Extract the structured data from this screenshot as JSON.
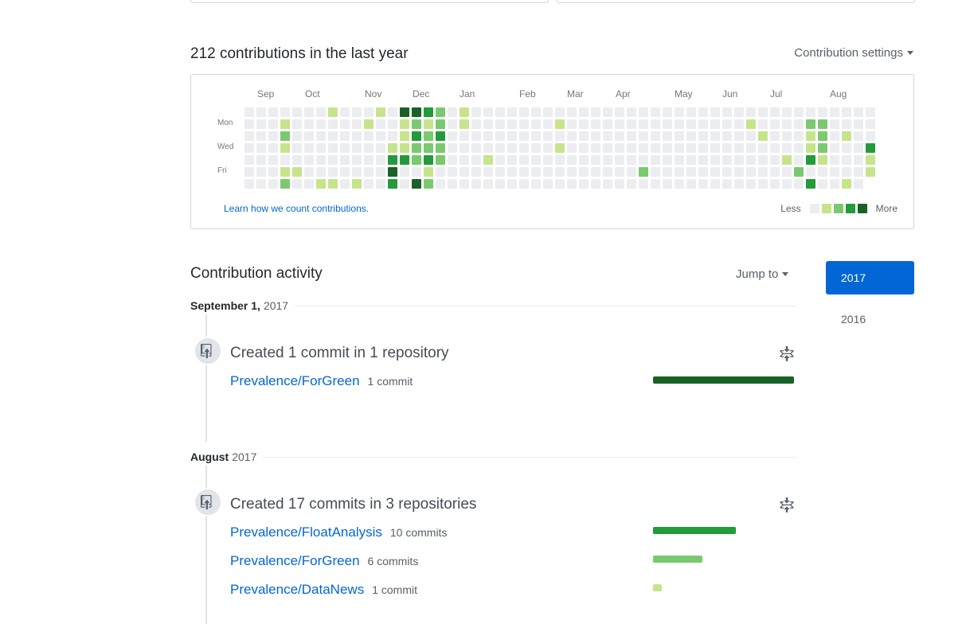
{
  "calendar": {
    "title": "212 contributions in the last year",
    "settings_label": "Contribution settings",
    "months": [
      "Sep",
      "Oct",
      "Nov",
      "Dec",
      "Jan",
      "Feb",
      "Mar",
      "Apr",
      "May",
      "Jun",
      "Jul",
      "Aug"
    ],
    "day_labels": [
      "Mon",
      "Wed",
      "Fri"
    ],
    "learn_link": "Learn how we count contributions.",
    "legend_less": "Less",
    "legend_more": "More",
    "colors": [
      "#ebedf0",
      "#c6e48b",
      "#7bc96f",
      "#239a3b",
      "#196127"
    ],
    "contribution_levels": [
      {
        "week": 3,
        "day": 0,
        "level": 0
      },
      {
        "week": 7,
        "day": 0,
        "level": 1
      },
      {
        "week": 11,
        "day": 0,
        "level": 1
      },
      {
        "week": 13,
        "day": 0,
        "level": 4
      },
      {
        "week": 14,
        "day": 0,
        "level": 4
      },
      {
        "week": 15,
        "day": 0,
        "level": 3
      },
      {
        "week": 16,
        "day": 0,
        "level": 2
      },
      {
        "week": 18,
        "day": 0,
        "level": 1
      },
      {
        "week": 3,
        "day": 1,
        "level": 1
      },
      {
        "week": 10,
        "day": 1,
        "level": 1
      },
      {
        "week": 13,
        "day": 1,
        "level": 1
      },
      {
        "week": 14,
        "day": 1,
        "level": 2
      },
      {
        "week": 15,
        "day": 1,
        "level": 1
      },
      {
        "week": 16,
        "day": 1,
        "level": 2
      },
      {
        "week": 18,
        "day": 1,
        "level": 1
      },
      {
        "week": 26,
        "day": 1,
        "level": 1
      },
      {
        "week": 42,
        "day": 1,
        "level": 1
      },
      {
        "week": 47,
        "day": 1,
        "level": 2
      },
      {
        "week": 48,
        "day": 1,
        "level": 2
      },
      {
        "week": 3,
        "day": 2,
        "level": 2
      },
      {
        "week": 13,
        "day": 2,
        "level": 1
      },
      {
        "week": 14,
        "day": 2,
        "level": 3
      },
      {
        "week": 15,
        "day": 2,
        "level": 2
      },
      {
        "week": 16,
        "day": 2,
        "level": 3
      },
      {
        "week": 43,
        "day": 2,
        "level": 1
      },
      {
        "week": 47,
        "day": 2,
        "level": 1
      },
      {
        "week": 48,
        "day": 2,
        "level": 2
      },
      {
        "week": 50,
        "day": 2,
        "level": 1
      },
      {
        "week": 3,
        "day": 3,
        "level": 1
      },
      {
        "week": 12,
        "day": 3,
        "level": 1
      },
      {
        "week": 13,
        "day": 3,
        "level": 1
      },
      {
        "week": 14,
        "day": 3,
        "level": 2
      },
      {
        "week": 15,
        "day": 3,
        "level": 2
      },
      {
        "week": 16,
        "day": 3,
        "level": 2
      },
      {
        "week": 26,
        "day": 3,
        "level": 1
      },
      {
        "week": 47,
        "day": 3,
        "level": 1
      },
      {
        "week": 48,
        "day": 3,
        "level": 2
      },
      {
        "week": 52,
        "day": 3,
        "level": 3
      },
      {
        "week": 12,
        "day": 4,
        "level": 3
      },
      {
        "week": 13,
        "day": 4,
        "level": 3
      },
      {
        "week": 14,
        "day": 4,
        "level": 2
      },
      {
        "week": 15,
        "day": 4,
        "level": 3
      },
      {
        "week": 16,
        "day": 4,
        "level": 2
      },
      {
        "week": 20,
        "day": 4,
        "level": 1
      },
      {
        "week": 45,
        "day": 4,
        "level": 1
      },
      {
        "week": 47,
        "day": 4,
        "level": 3
      },
      {
        "week": 48,
        "day": 4,
        "level": 1
      },
      {
        "week": 52,
        "day": 4,
        "level": 1
      },
      {
        "week": 3,
        "day": 5,
        "level": 1
      },
      {
        "week": 4,
        "day": 5,
        "level": 1
      },
      {
        "week": 12,
        "day": 5,
        "level": 4
      },
      {
        "week": 15,
        "day": 5,
        "level": 1
      },
      {
        "week": 33,
        "day": 5,
        "level": 2
      },
      {
        "week": 46,
        "day": 5,
        "level": 2
      },
      {
        "week": 52,
        "day": 5,
        "level": 1
      },
      {
        "week": 3,
        "day": 6,
        "level": 2
      },
      {
        "week": 6,
        "day": 6,
        "level": 1
      },
      {
        "week": 7,
        "day": 6,
        "level": 1
      },
      {
        "week": 9,
        "day": 6,
        "level": 1
      },
      {
        "week": 12,
        "day": 6,
        "level": 3
      },
      {
        "week": 14,
        "day": 6,
        "level": 4
      },
      {
        "week": 15,
        "day": 6,
        "level": 2
      },
      {
        "week": 47,
        "day": 6,
        "level": 3
      },
      {
        "week": 50,
        "day": 6,
        "level": 1
      }
    ]
  },
  "activity": {
    "title": "Contribution activity",
    "jump_label": "Jump to",
    "years": [
      "2017",
      "2016"
    ],
    "bar_colors": [
      "#196127",
      "#239a3b",
      "#7bc96f",
      "#c6e48b"
    ],
    "sections": [
      {
        "month": "September 1,",
        "year": "2017",
        "summary": "Created 1 commit in 1 repository",
        "repos": [
          {
            "name": "Prevalence/ForGreen",
            "count": "1 commit",
            "share": 1.0
          }
        ]
      },
      {
        "month": "August",
        "year": "2017",
        "summary": "Created 17 commits in 3 repositories",
        "repos": [
          {
            "name": "Prevalence/FloatAnalysis",
            "count": "10 commits",
            "share": 0.59
          },
          {
            "name": "Prevalence/ForGreen",
            "count": "6 commits",
            "share": 0.35
          },
          {
            "name": "Prevalence/DataNews",
            "count": "1 commit",
            "share": 0.06
          }
        ]
      }
    ]
  }
}
